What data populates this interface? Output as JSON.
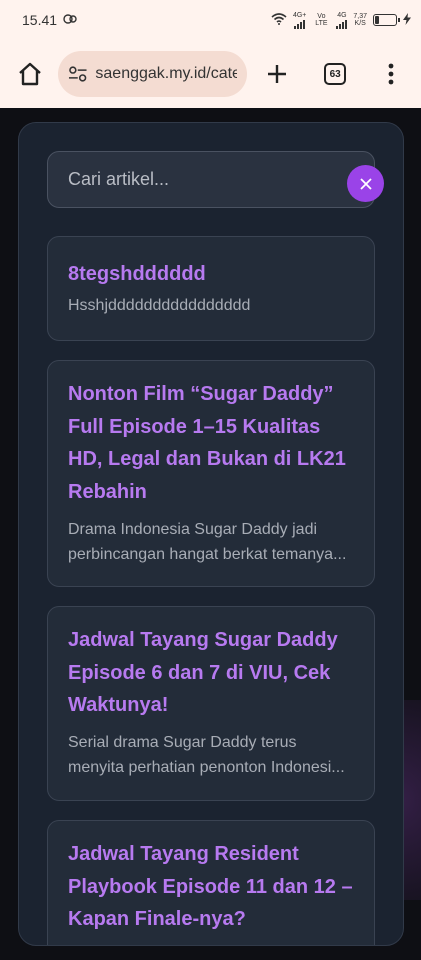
{
  "status_bar": {
    "time": "15.41",
    "network_4g": "4G+",
    "volte": "Vo LTE",
    "network_4g_2": "4G",
    "speed": "7,37",
    "speed_unit": "K/S",
    "icons": [
      "notification-icon",
      "wifi-icon",
      "signal-icon",
      "battery-icon",
      "charging-icon"
    ],
    "battery_level": 0.2
  },
  "browser": {
    "url": "saenggak.my.id/cate",
    "tab_count": "63",
    "icons": [
      "home-icon",
      "site-settings-icon",
      "new-tab-icon",
      "menu-icon"
    ]
  },
  "search": {
    "placeholder": "Cari artikel...",
    "value": ""
  },
  "articles": [
    {
      "title": "8tegshdddddd",
      "excerpt": "Hsshjdddddddddddddddd"
    },
    {
      "title": "Nonton Film “Sugar Daddy” Full Episode 1–15 Kualitas HD, Legal dan Bukan di LK21 Rebahin",
      "excerpt": "Drama Indonesia Sugar Daddy jadi perbincangan hangat berkat temanya..."
    },
    {
      "title": "Jadwal Tayang Sugar Daddy Episode 6 dan 7 di VIU, Cek Waktunya!",
      "excerpt": "Serial drama Sugar Daddy terus menyita perhatian penonton Indonesi..."
    },
    {
      "title": "Jadwal Tayang Resident Playbook Episode 11 dan 12 – Kapan Finale-nya?",
      "excerpt": ""
    }
  ],
  "colors": {
    "accent": "#9a43e8",
    "title": "#b77af0",
    "panel": "#1b2330",
    "card": "#232c39"
  }
}
